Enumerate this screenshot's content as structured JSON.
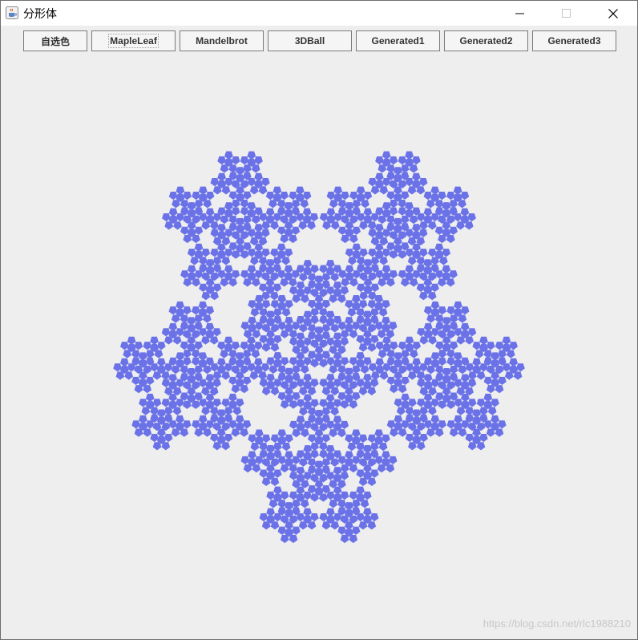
{
  "window": {
    "title": "分形体",
    "icon": "java-cup-icon"
  },
  "toolbar": {
    "buttons": [
      {
        "label": "自选色"
      },
      {
        "label": "MapleLeaf"
      },
      {
        "label": "Mandelbrot"
      },
      {
        "label": "3DBall"
      },
      {
        "label": "Generated1"
      },
      {
        "label": "Generated2"
      },
      {
        "label": "Generated3"
      }
    ]
  },
  "canvas": {
    "fractal_color": "#6b72e8",
    "background_color": "#eeeeee"
  },
  "watermark": "https://blog.csdn.net/rlc1988210"
}
